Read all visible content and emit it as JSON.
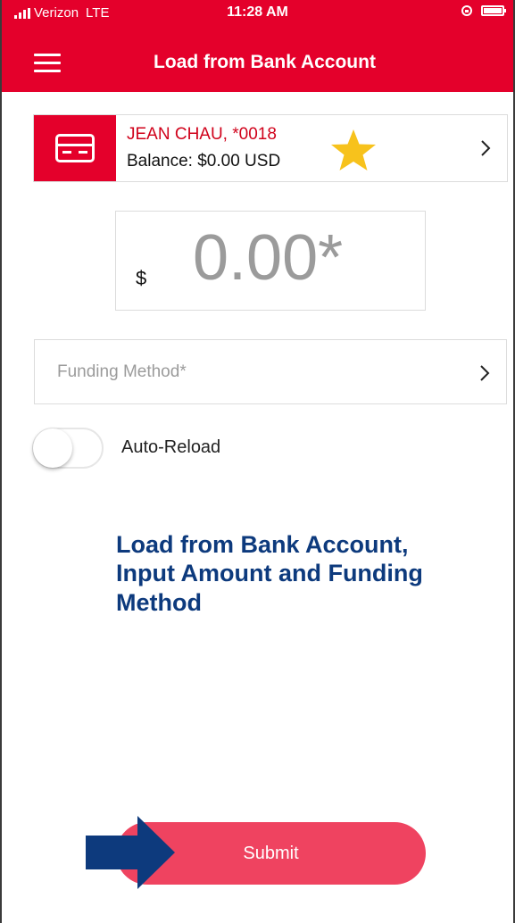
{
  "status_bar": {
    "carrier": "Verizon",
    "network": "LTE",
    "time": "11:28 AM"
  },
  "header": {
    "title": "Load from Bank Account",
    "menu_icon": "hamburger-menu-icon"
  },
  "account": {
    "name": "JEAN CHAU, *0018",
    "balance": "Balance: $0.00 USD",
    "icon": "credit-card-icon",
    "favorite_icon": "star-icon"
  },
  "amount": {
    "currency": "$",
    "value": "0.00*"
  },
  "funding": {
    "placeholder": "Funding Method*"
  },
  "auto_reload": {
    "label": "Auto-Reload",
    "enabled": false
  },
  "annotation": {
    "text": "Load from Bank Account, Input Amount and Funding Method"
  },
  "submit": {
    "label": "Submit"
  },
  "colors": {
    "brand_red": "#e4002b",
    "submit_pink": "#ef4360",
    "annotation_blue": "#0d3a7d",
    "star_yellow": "#f7c21c"
  }
}
